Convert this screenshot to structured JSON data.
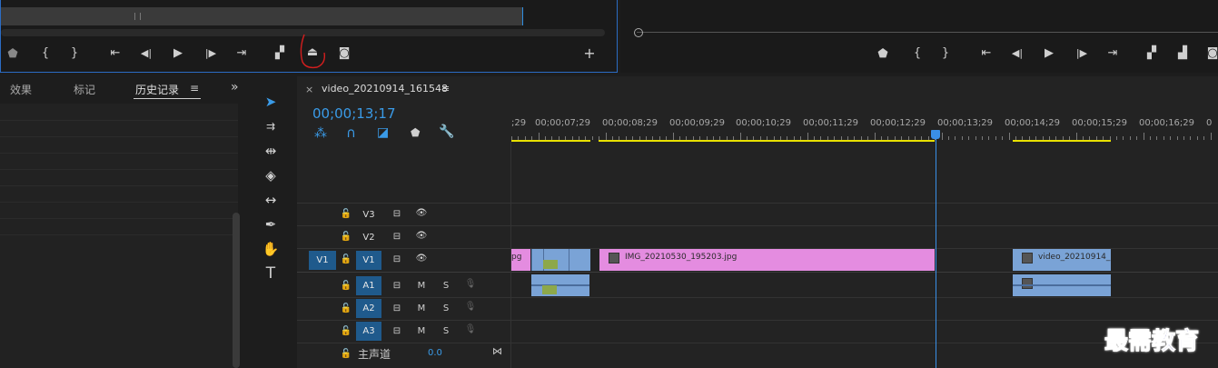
{
  "source_monitor": {
    "controls": [
      "marker-icon",
      "mark-in-icon",
      "mark-out-icon",
      "go-to-in-icon",
      "step-back-icon",
      "play-icon",
      "step-forward-icon",
      "go-to-out-icon",
      "insert-icon",
      "overwrite-icon",
      "export-frame-icon",
      "add-button-icon"
    ]
  },
  "program_monitor": {
    "timecode": "00;00;13;17"
  },
  "left_panel": {
    "tabs": [
      {
        "label": "效果"
      },
      {
        "label": "标记"
      },
      {
        "label": "历史记录"
      }
    ],
    "active_tab": "历史记录",
    "menu_icon": "≡",
    "expand_icon": "»"
  },
  "timeline": {
    "close": "×",
    "sequence_name": "video_20210914_161548",
    "menu_icon": "≡",
    "timecode": "00;00;13;17",
    "ruler_labels": [
      ";29",
      "00;00;07;29",
      "00;00;08;29",
      "00;00;09;29",
      "00;00;10;29",
      "00;00;11;29",
      "00;00;12;29",
      "00;00;13;29",
      "00;00;14;29",
      "00;00;15;29",
      "00;00;16;29"
    ],
    "tracks": {
      "video": [
        {
          "name": "V3",
          "target": ""
        },
        {
          "name": "V2",
          "target": ""
        },
        {
          "name": "V1",
          "target": "V1"
        }
      ],
      "audio": [
        {
          "name": "A1",
          "mute": "M",
          "solo": "S"
        },
        {
          "name": "A2",
          "mute": "M",
          "solo": "S"
        },
        {
          "name": "A3",
          "mute": "M",
          "solo": "S"
        }
      ],
      "master": {
        "label": "主声道",
        "value": "0.0"
      }
    },
    "clips": {
      "left_fragment": "pg",
      "image_clip": "IMG_20210530_195203.jpg",
      "video_clip": "video_20210914_"
    }
  },
  "watermark": "最需教育",
  "colors": {
    "accent_blue": "#2f8ee0",
    "clip_pink": "#e48ce0",
    "clip_blue": "#7aa3d6",
    "in_out_yellow": "#e8e000",
    "playhead": "#3a8fe6"
  }
}
